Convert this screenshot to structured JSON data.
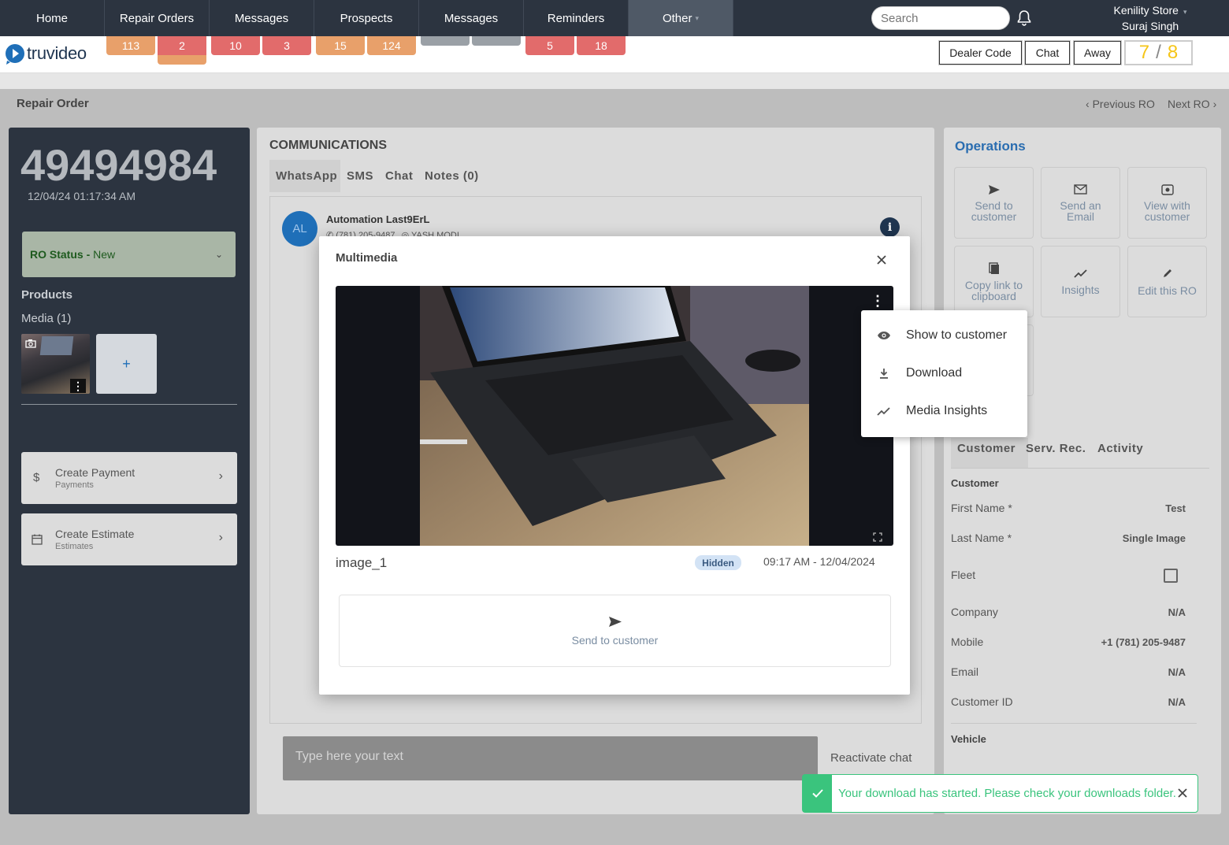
{
  "nav": {
    "tabs": [
      {
        "label": "Home",
        "badges": []
      },
      {
        "label": "Repair Orders",
        "badges": [
          "113",
          "2"
        ]
      },
      {
        "label": "Messages",
        "badges": [
          "10",
          "3"
        ]
      },
      {
        "label": "Prospects",
        "badges": [
          "15",
          "124"
        ]
      },
      {
        "label": "Messages",
        "badges": [
          "",
          ""
        ]
      },
      {
        "label": "Reminders",
        "badges": [
          "5",
          "18"
        ]
      },
      {
        "label": "Other",
        "badges": []
      }
    ],
    "search_placeholder": "Search",
    "store": "Kenility Store",
    "user": "Suraj Singh"
  },
  "brand": {
    "logo_text": "truvideo"
  },
  "toolbar": {
    "dealer_code": "Dealer Code",
    "chat": "Chat",
    "away": "Away",
    "counter_a": "7",
    "counter_sep": "/",
    "counter_b": "8"
  },
  "page": {
    "title": "Repair Order",
    "prev": "Previous RO",
    "next": "Next RO"
  },
  "ro": {
    "number": "49494984",
    "datetime": "12/04/24 01:17:34 AM",
    "status_label": "RO Status - ",
    "status_value": "New",
    "products": "Products",
    "media": "Media (1)",
    "add": "+",
    "create_payment": "Create Payment",
    "payments": "Payments",
    "create_estimate": "Create Estimate",
    "estimates": "Estimates"
  },
  "comms": {
    "title": "COMMUNICATIONS",
    "tabs": [
      "WhatsApp",
      "SMS",
      "Chat",
      "Notes (0)"
    ],
    "avatar": "AL",
    "contact_name": "Automation Last9ErL",
    "contact_phone": "(781) 205-9487",
    "contact_agent": "YASH MODI",
    "input_placeholder": "Type here your text",
    "reactivate": "Reactivate chat"
  },
  "operations": {
    "title": "Operations",
    "tiles": [
      {
        "label": "Send to customer",
        "icon": "send-icon"
      },
      {
        "label": "Send an Email",
        "icon": "email-icon"
      },
      {
        "label": "View with customer",
        "icon": "view-icon"
      },
      {
        "label": "Copy link to clipboard",
        "icon": "copy-icon"
      },
      {
        "label": "Insights",
        "icon": "insights-icon"
      },
      {
        "label": "Edit this RO",
        "icon": "edit-icon"
      }
    ],
    "tabs": [
      "Customer",
      "Serv. Rec.",
      "Activity"
    ],
    "section": "Customer",
    "fields": [
      {
        "label": "First Name *",
        "value": "Test"
      },
      {
        "label": "Last Name *",
        "value": "Single Image"
      },
      {
        "label": "Fleet",
        "value": ""
      },
      {
        "label": "Company",
        "value": "N/A"
      },
      {
        "label": "Mobile",
        "value": "+1 (781) 205-9487"
      },
      {
        "label": "Email",
        "value": "N/A"
      },
      {
        "label": "Customer ID",
        "value": "N/A"
      }
    ],
    "vehicle": "Vehicle"
  },
  "modal": {
    "title": "Multimedia",
    "filename": "image_1",
    "visibility": "Hidden",
    "timestamp": "09:17 AM - 12/04/2024",
    "send_label": "Send to customer"
  },
  "menu": {
    "items": [
      {
        "label": "Show to customer",
        "icon": "eye-icon"
      },
      {
        "label": "Download",
        "icon": "download-icon"
      },
      {
        "label": "Media Insights",
        "icon": "insights-icon"
      }
    ]
  },
  "toast": {
    "message": "Your download has started. Please check your downloads folder."
  },
  "colors": {
    "nav_bg": "#2c3440",
    "badge_orange": "#e8a06a",
    "badge_red": "#e26b6b",
    "accent_blue": "#1f6fb8",
    "success": "#3ac47d",
    "counter": "#f5c518"
  }
}
